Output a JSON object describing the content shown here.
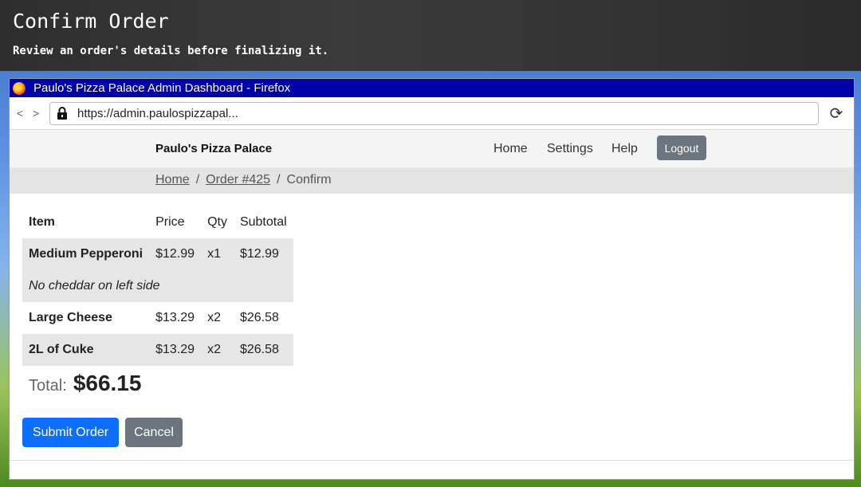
{
  "banner": {
    "title": "Confirm Order",
    "subtitle": "Review an order's details before finalizing it."
  },
  "window": {
    "title": "Paulo's Pizza Palace Admin Dashboard - Firefox",
    "nav_arrows": "< >",
    "url": "https://admin.paulospizzapal..."
  },
  "navbar": {
    "brand": "Paulo's Pizza Palace",
    "links": [
      "Home",
      "Settings",
      "Help"
    ],
    "logout": "Logout"
  },
  "breadcrumb": {
    "home": "Home",
    "order": "Order #425",
    "current": "Confirm",
    "separator": "/"
  },
  "table": {
    "headers": [
      "Item",
      "Price",
      "Qty",
      "Subtotal"
    ],
    "rows": [
      {
        "item": "Medium Pepperoni",
        "price": "$12.99",
        "qty": "x1",
        "subtotal": "$12.99",
        "note": "No cheddar on left side"
      },
      {
        "item": "Large Cheese",
        "price": "$13.29",
        "qty": "x2",
        "subtotal": "$26.58"
      },
      {
        "item": "2L of Cuke",
        "price": "$13.29",
        "qty": "x2",
        "subtotal": "$26.58"
      }
    ]
  },
  "total": {
    "label": "Total:",
    "value": "$66.15"
  },
  "buttons": {
    "submit": "Submit Order",
    "cancel": "Cancel"
  },
  "colors": {
    "primary": "#0d6efd",
    "secondary": "#6c757d",
    "titlebar": "#0000a8"
  }
}
